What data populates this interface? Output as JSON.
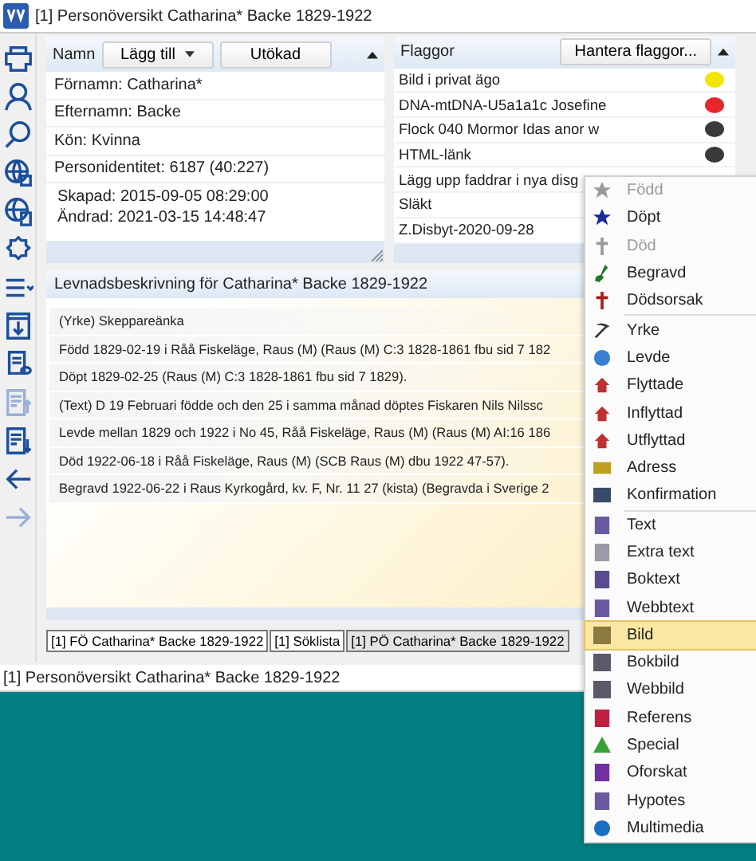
{
  "window": {
    "title": "[1] Personöversikt Catharina* Backe 1829-1922"
  },
  "name_panel": {
    "title": "Namn",
    "add_button": "Lägg till",
    "extended_button": "Utökad",
    "rows": [
      "Förnamn: Catharina*",
      "Efternamn: Backe",
      "Kön: Kvinna",
      "Personidentitet: 6187 (40:227)"
    ],
    "created": "Skapad:  2015-09-05  08:29:00",
    "changed": "Ändrad:  2021-03-15  14:48:47"
  },
  "flags_panel": {
    "title": "Flaggor",
    "manage_button": "Hantera flaggor...",
    "flags": [
      {
        "label": "Bild i privat ägo",
        "color": "#f2e600"
      },
      {
        "label": "DNA-mtDNA-U5a1a1c Josefine",
        "color": "#e8262b"
      },
      {
        "label": "Flock 040 Mormor Idas anor w",
        "color": "#3a3a3a"
      },
      {
        "label": "HTML-länk",
        "color": "#3a3a3a"
      },
      {
        "label": "Lägg upp faddrar i nya disg"
      },
      {
        "label": "Släkt"
      },
      {
        "label": "Z.Disbyt-2020-09-28"
      }
    ]
  },
  "life_panel": {
    "title": "Levnadsbeskrivning för Catharina* Backe 1829-1922",
    "lines": [
      "(Yrke) Skeppareänka",
      "Född 1829-02-19 i Råå Fiskeläge, Raus (M) (Raus (M) C:3 1828-1861 fbu sid  7 182",
      "Döpt 1829-02-25 (Raus (M) C:3 1828-1861 fbu sid  7 1829).",
      "(Text) D 19 Februari födde och den 25 i samma månad döptes Fiskaren Nils Nilssc",
      "Levde mellan 1829 och 1922 i No 45, Råå Fiskeläge, Raus (M) (Raus (M) AI:16 186",
      "Död 1922-06-18 i Råå Fiskeläge, Raus (M) (SCB Raus (M) dbu 1922 47-57).",
      "Begravd 1922-06-22 i Raus Kyrkogård, kv. F, Nr. 11 27 (kista) (Begravda i Sverige 2"
    ]
  },
  "tabs": [
    {
      "label": "[1] FÖ Catharina* Backe 1829-1922",
      "selected": false
    },
    {
      "label": "[1] Söklista",
      "selected": false
    },
    {
      "label": "[1] PÖ Catharina* Backe 1829-1922",
      "selected": true
    }
  ],
  "status_bar": "[1] Personöversikt Catharina* Backe 1829-1922",
  "context_menu": {
    "groups": [
      [
        {
          "label": "Född",
          "disabled": true,
          "selected": false
        },
        {
          "label": "Döpt",
          "disabled": false,
          "selected": false
        },
        {
          "label": "Död",
          "disabled": true,
          "selected": false
        },
        {
          "label": "Begravd",
          "disabled": false,
          "selected": false
        },
        {
          "label": "Dödsorsak",
          "disabled": false,
          "selected": false
        }
      ],
      [
        {
          "label": "Yrke",
          "disabled": false,
          "selected": false
        },
        {
          "label": "Levde",
          "disabled": false,
          "selected": false
        },
        {
          "label": "Flyttade",
          "disabled": false,
          "selected": false
        },
        {
          "label": "Inflyttad",
          "disabled": false,
          "selected": false
        },
        {
          "label": "Utflyttad",
          "disabled": false,
          "selected": false
        },
        {
          "label": "Adress",
          "disabled": false,
          "selected": false
        },
        {
          "label": "Konfirmation",
          "disabled": false,
          "selected": false
        }
      ],
      [
        {
          "label": "Text",
          "disabled": false,
          "selected": false
        },
        {
          "label": "Extra text",
          "disabled": false,
          "selected": false
        },
        {
          "label": "Boktext",
          "disabled": false,
          "selected": false
        },
        {
          "label": "Webbtext",
          "disabled": false,
          "selected": false
        },
        {
          "label": "Bild",
          "disabled": false,
          "selected": true
        },
        {
          "label": "Bokbild",
          "disabled": false,
          "selected": false
        },
        {
          "label": "Webbild",
          "disabled": false,
          "selected": false
        },
        {
          "label": "Referens",
          "disabled": false,
          "selected": false
        },
        {
          "label": "Special",
          "disabled": false,
          "selected": false
        },
        {
          "label": "Oforskat",
          "disabled": false,
          "selected": false
        },
        {
          "label": "Hypotes",
          "disabled": false,
          "selected": false
        },
        {
          "label": "Multimedia",
          "disabled": false,
          "selected": false
        }
      ]
    ]
  }
}
